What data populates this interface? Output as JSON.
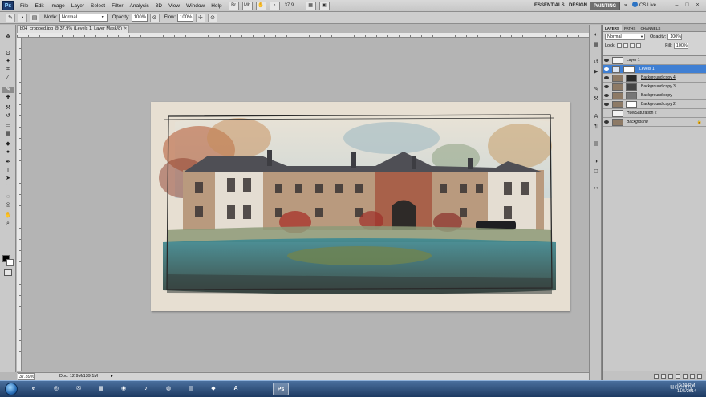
{
  "app": {
    "logo": "Ps",
    "menu": [
      "File",
      "Edit",
      "Image",
      "Layer",
      "Select",
      "Filter",
      "Analysis",
      "3D",
      "View",
      "Window",
      "Help"
    ],
    "zoom": "37.9",
    "workspaces": [
      "ESSENTIALS",
      "DESIGN",
      "PAINTING",
      "»"
    ],
    "active_workspace": "PAINTING",
    "cs_live": "CS Live",
    "window_controls": [
      "–",
      "□",
      "×"
    ]
  },
  "options": {
    "mode_label": "Mode:",
    "mode_value": "Normal",
    "opacity_label": "Opacity:",
    "opacity_value": "100%",
    "flow_label": "Flow:",
    "flow_value": "100%"
  },
  "document": {
    "tab_title": "b04_cropped.jpg @ 37.9% (Levels 1, Layer Mask/8) *",
    "tab_close": "×",
    "zoom_status": "37.89%",
    "doc_status": "Doc: 12.9M/139.1M",
    "status_arrow": "▸"
  },
  "layers_panel": {
    "tabs": [
      "LAYERS",
      "PATHS",
      "CHANNELS"
    ],
    "blend_mode": "Normal",
    "opacity_label": "Opacity:",
    "opacity_value": "100%",
    "lock_label": "Lock:",
    "fill_label": "Fill:",
    "fill_value": "100%",
    "layers": [
      {
        "name": "Layer 1",
        "selected": false
      },
      {
        "name": "Levels 1",
        "selected": true
      },
      {
        "name": "Background copy 4",
        "selected": false
      },
      {
        "name": "Background copy 3",
        "selected": false
      },
      {
        "name": "Background copy",
        "selected": false
      },
      {
        "name": "Background copy 2",
        "selected": false
      },
      {
        "name": "Hue/Saturation 2",
        "selected": false
      },
      {
        "name": "Background",
        "selected": false
      }
    ]
  },
  "taskbar": {
    "apps": [
      "e",
      "◎",
      "✉",
      "▦",
      "◉",
      "♪",
      "◍",
      "▤",
      "◆",
      "A",
      "Ps"
    ],
    "active_app": "Ps",
    "clock_time": "3:19 PM",
    "clock_date": "11/5/2014",
    "watermark": "udemy"
  },
  "colors": {
    "selection": "#3f7fd3",
    "taskbar": "#1d3a62",
    "canvas_bg": "#b4b4b4"
  }
}
